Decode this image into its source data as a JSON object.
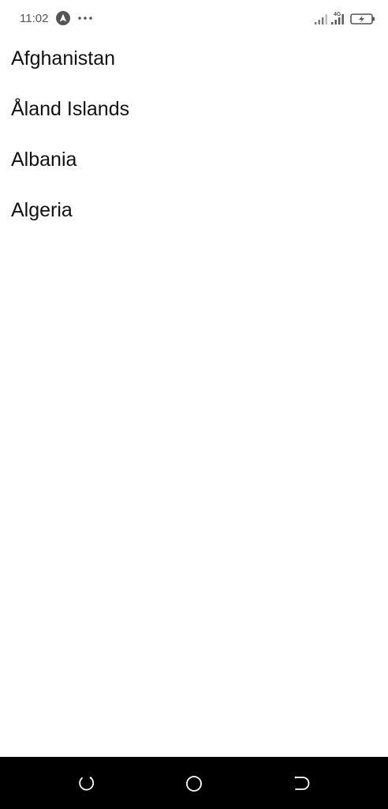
{
  "status_bar": {
    "time": "11:02",
    "app_icon": "navigation-arrow-icon",
    "more_icon": "more-dots-icon",
    "signal_icon": "cell-signal-icon",
    "signal_4g_icon": "cell-signal-4g-icon",
    "network_label": "4G",
    "battery_icon": "battery-charging-icon"
  },
  "countries": [
    {
      "label": "Afghanistan"
    },
    {
      "label": "Åland Islands"
    },
    {
      "label": "Albania"
    },
    {
      "label": "Algeria"
    }
  ],
  "nav_bar": {
    "recents_icon": "recents-icon",
    "home_icon": "home-circle-icon",
    "back_icon": "back-icon"
  },
  "colors": {
    "background": "#ffffff",
    "text": "#111111",
    "status_text": "#555555",
    "nav_bar": "#000000"
  }
}
